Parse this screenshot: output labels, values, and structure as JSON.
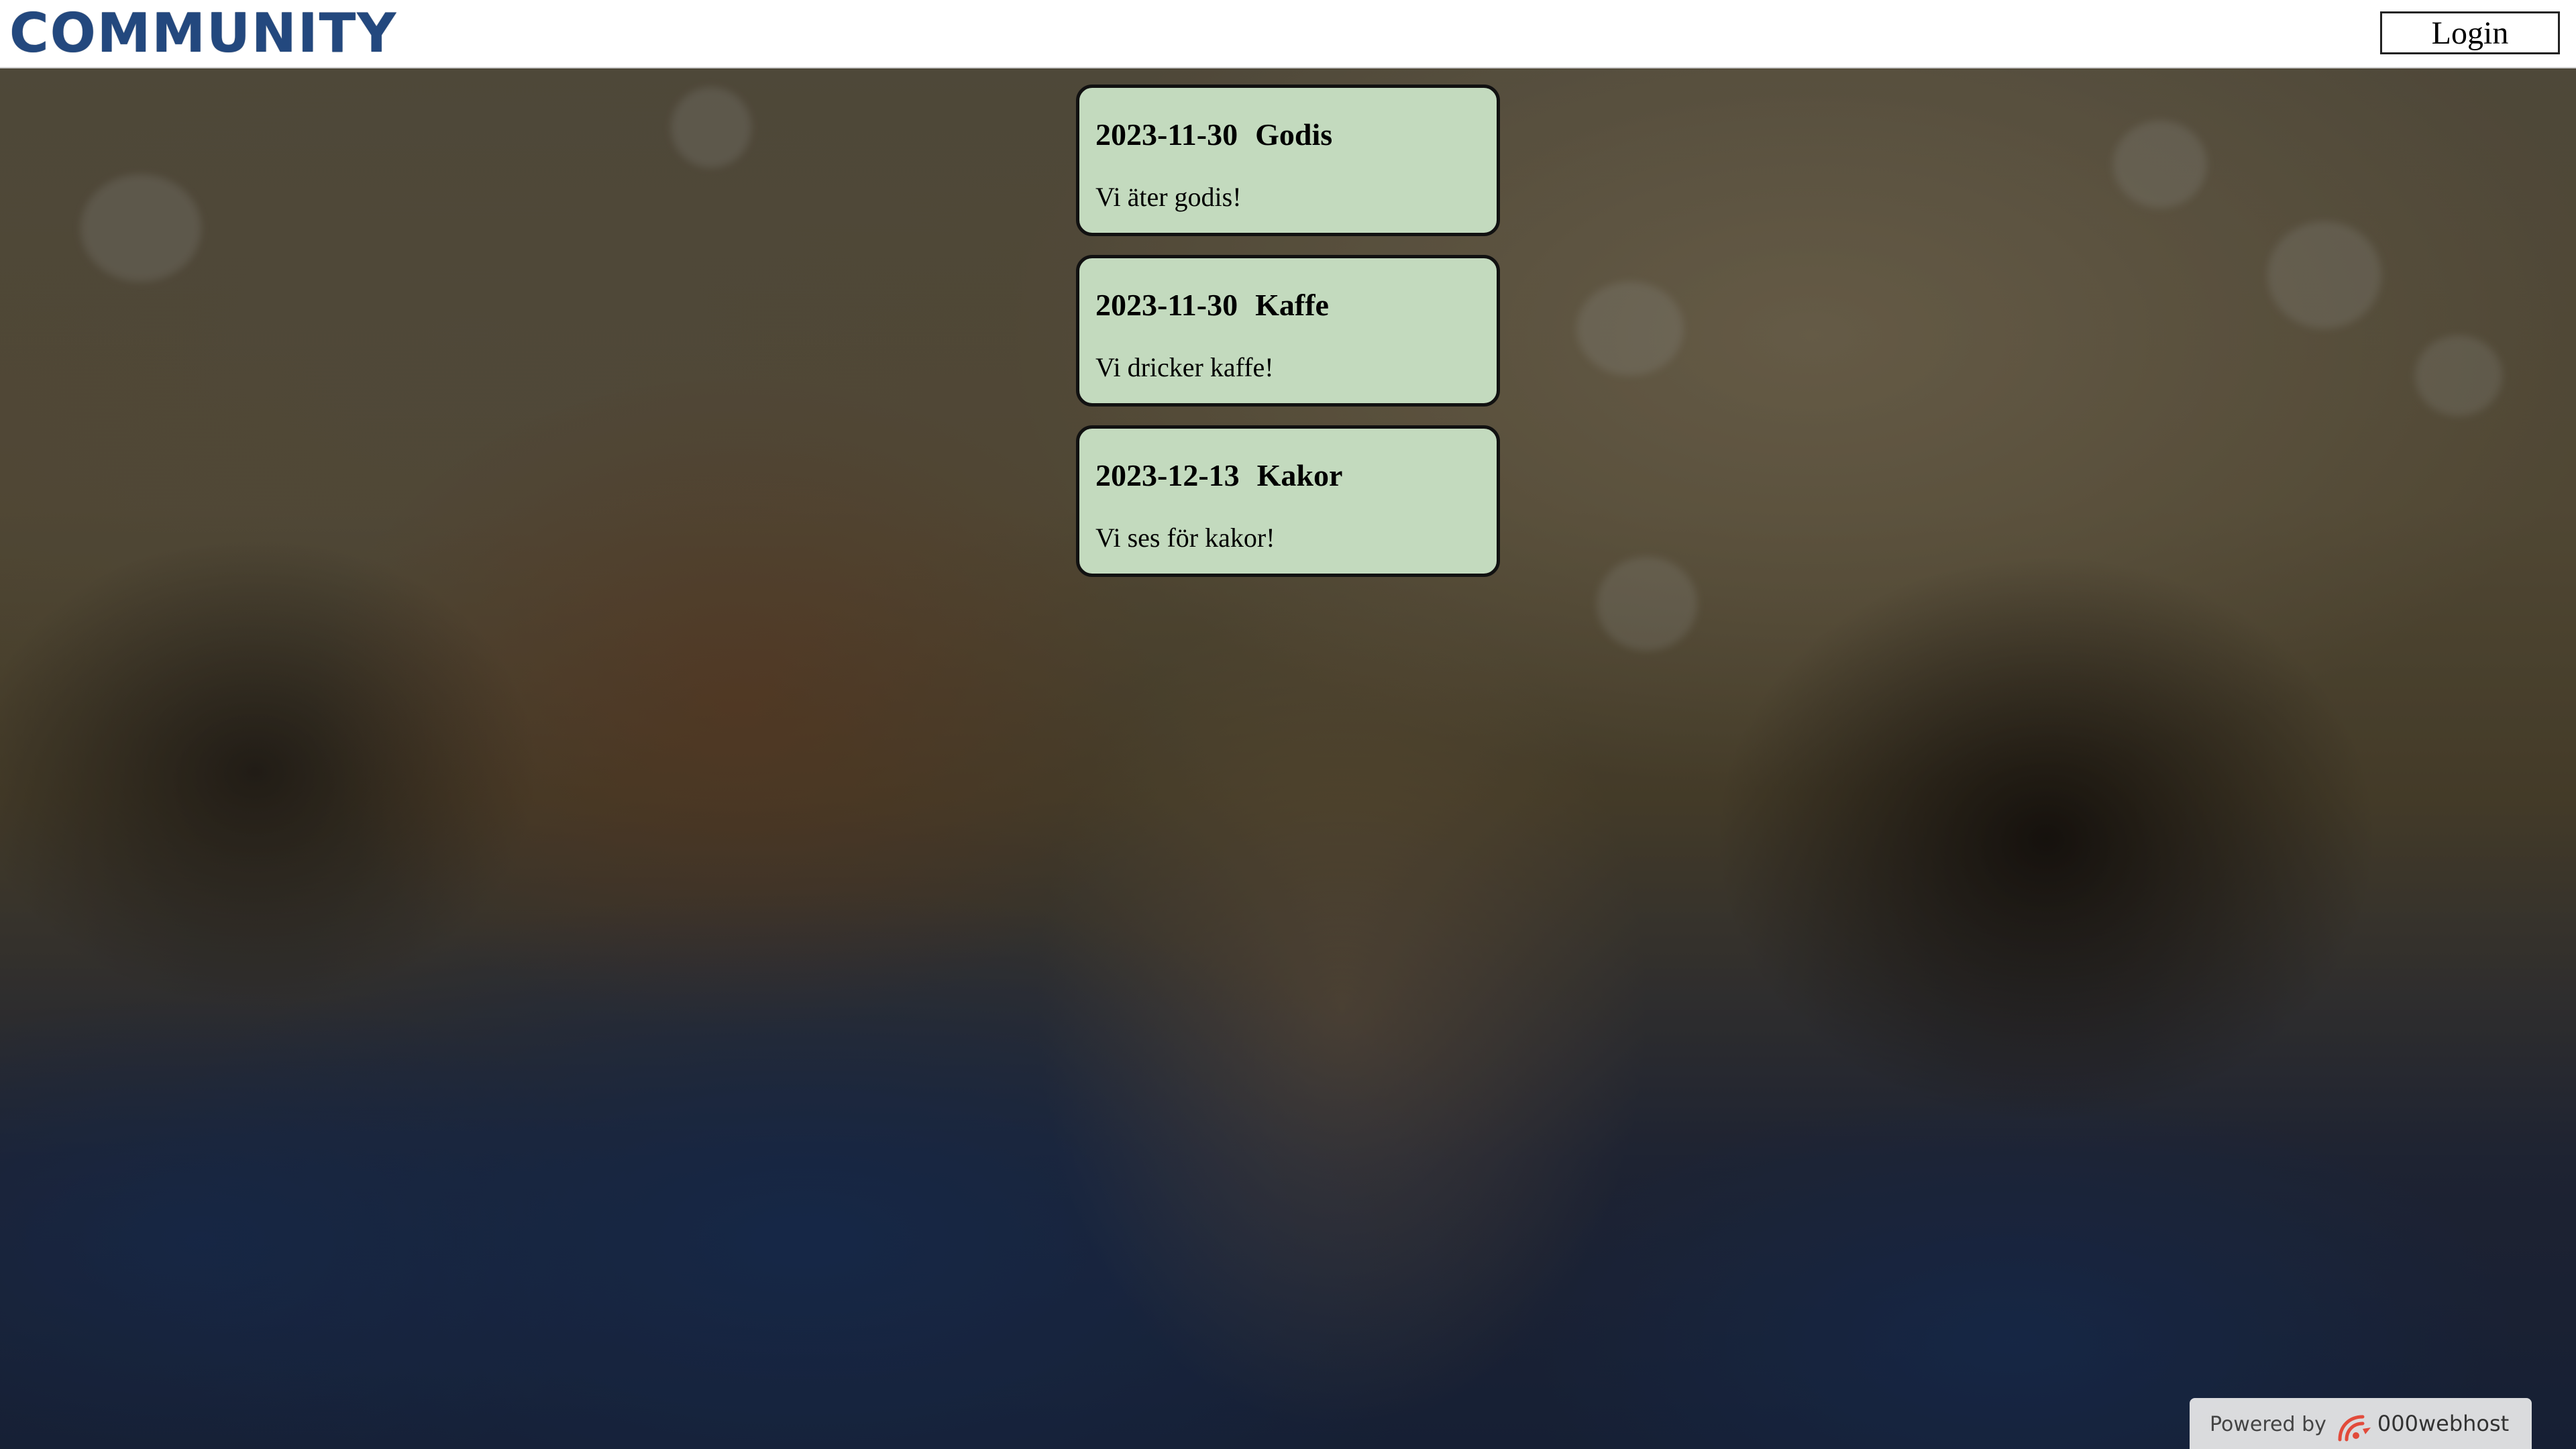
{
  "header": {
    "logo_text": "COMMUNITY",
    "login_label": "Login"
  },
  "events": [
    {
      "date": "2023-11-30",
      "title": "Godis",
      "description": "Vi äter godis!"
    },
    {
      "date": "2023-11-30",
      "title": "Kaffe",
      "description": "Vi dricker kaffe!"
    },
    {
      "date": "2023-12-13",
      "title": "Kakor",
      "description": "Vi ses för kakor!"
    }
  ],
  "footer": {
    "powered_by_label": "Powered by",
    "host_name": "000webhost",
    "host_icon": "000webhost-logo-icon"
  },
  "colors": {
    "logo": "#23487e",
    "event_card_bg": "#c3dabe",
    "event_card_border": "#111111",
    "header_bg": "#ffffff"
  },
  "background": {
    "image": "group-hug-photo",
    "overlay": "darkened"
  }
}
